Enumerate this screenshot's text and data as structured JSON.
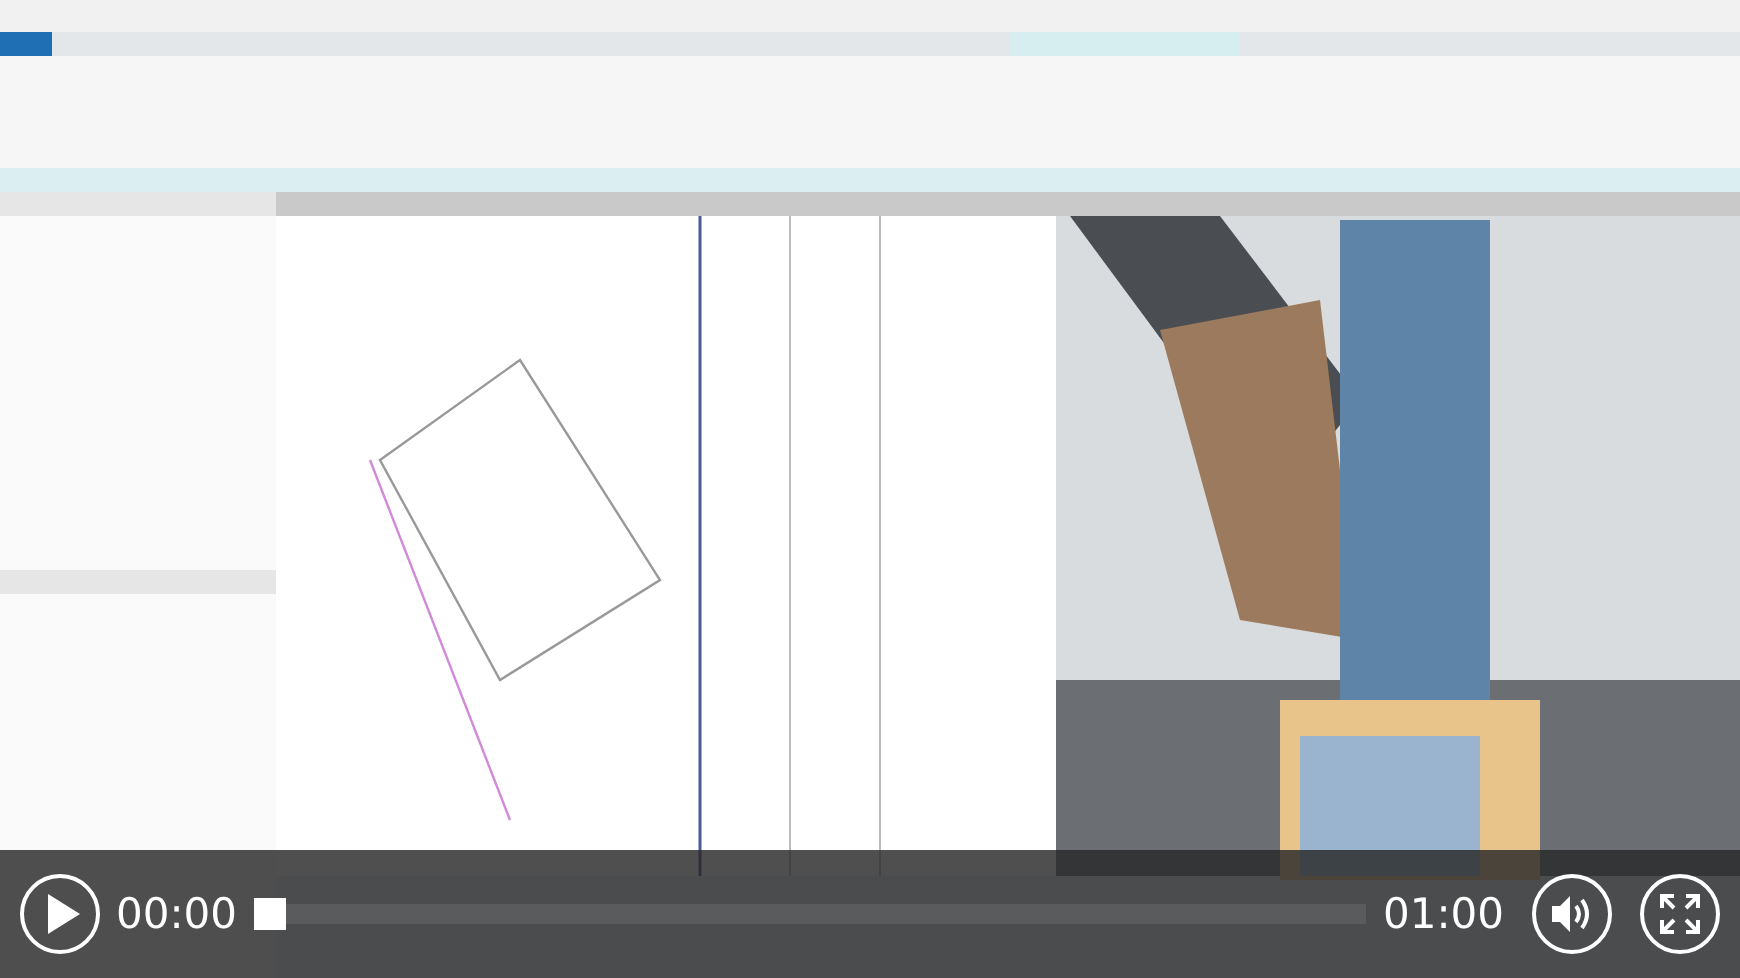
{
  "video_player": {
    "playing": false,
    "current_time": "00:00",
    "progress": {
      "level": 0
    },
    "duration": "01:00",
    "muted": false
  }
}
